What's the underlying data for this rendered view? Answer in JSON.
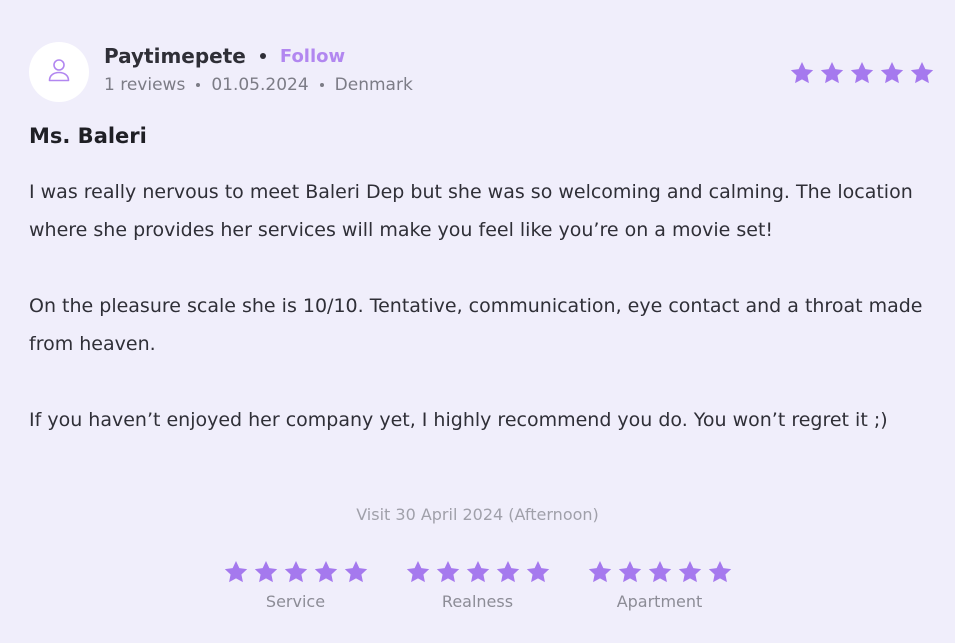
{
  "colors": {
    "background": "#f0eefb",
    "accent": "#b287f0",
    "star": "#a579ee",
    "text": "#2f2f37",
    "muted": "#7c7c86"
  },
  "reviewer": {
    "avatar_icon": "user-icon",
    "username": "Paytimepete",
    "follow_label": "Follow",
    "reviews_count": "1 reviews",
    "date": "01.05.2024",
    "country": "Denmark"
  },
  "overall_rating": {
    "value": 5,
    "max": 5
  },
  "review": {
    "title": "Ms. Baleri",
    "paragraphs": [
      "I was really nervous to meet Baleri Dep but she was so welcoming and calming. The location where she provides her services will make you feel like you’re on a movie set!",
      "On the pleasure scale she is 10/10. Tentative, communication, eye contact and a throat made from heaven.",
      "If you haven’t enjoyed her company yet, I highly recommend you do. You won’t regret it ;)"
    ]
  },
  "visit": "Visit 30 April 2024 (Afternoon)",
  "sub_ratings": [
    {
      "label": "Service",
      "value": 5,
      "max": 5
    },
    {
      "label": "Realness",
      "value": 5,
      "max": 5
    },
    {
      "label": "Apartment",
      "value": 5,
      "max": 5
    }
  ]
}
